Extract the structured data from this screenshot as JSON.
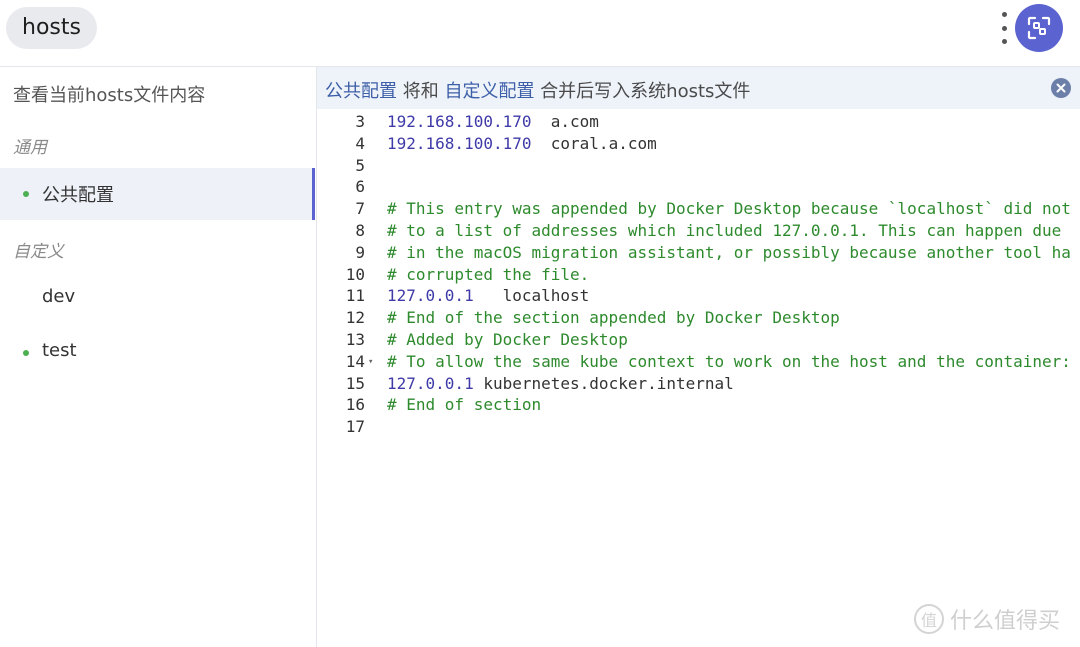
{
  "app": {
    "title": "hosts"
  },
  "toolbar": {
    "more_icon": "kebab-menu-icon",
    "action_icon": "switch-view-icon",
    "accent": "#5b63d0"
  },
  "sidebar": {
    "view_current": "查看当前hosts文件内容",
    "groups": [
      {
        "label": "通用"
      },
      {
        "label": "自定义"
      }
    ],
    "items": [
      {
        "label": "公共配置",
        "enabled": true,
        "active": true
      },
      {
        "label": "dev",
        "enabled": false,
        "active": false
      },
      {
        "label": "test",
        "enabled": true,
        "active": false
      }
    ]
  },
  "banner": {
    "part1": "公共配置",
    "part2": " 将和 ",
    "part3": "自定义配置",
    "part4": " 合并后写入系统hosts文件",
    "close_icon": "close-icon"
  },
  "editor": {
    "lines": [
      {
        "n": "3",
        "ip": "192.168.100.170",
        "rest": "  a.com",
        "type": "entry"
      },
      {
        "n": "4",
        "ip": "192.168.100.170",
        "rest": "  coral.a.com",
        "type": "entry"
      },
      {
        "n": "5",
        "text": "",
        "type": "blank"
      },
      {
        "n": "6",
        "text": "",
        "type": "blank"
      },
      {
        "n": "7",
        "text": "# This entry was appended by Docker Desktop because `localhost` did not",
        "type": "comment"
      },
      {
        "n": "8",
        "text": "# to a list of addresses which included 127.0.0.1. This can happen due",
        "type": "comment"
      },
      {
        "n": "9",
        "text": "# in the macOS migration assistant, or possibly because another tool ha",
        "type": "comment"
      },
      {
        "n": "10",
        "text": "# corrupted the file.",
        "type": "comment"
      },
      {
        "n": "11",
        "ip": "127.0.0.1",
        "rest": "   localhost",
        "type": "entry"
      },
      {
        "n": "12",
        "text": "# End of the section appended by Docker Desktop",
        "type": "comment"
      },
      {
        "n": "13",
        "text": "# Added by Docker Desktop",
        "type": "comment"
      },
      {
        "n": "14",
        "text": "# To allow the same kube context to work on the host and the container:",
        "type": "comment",
        "fold": true
      },
      {
        "n": "15",
        "ip": "127.0.0.1",
        "rest": " kubernetes.docker.internal",
        "type": "entry"
      },
      {
        "n": "16",
        "text": "# End of section",
        "type": "comment"
      },
      {
        "n": "17",
        "text": "",
        "type": "blank"
      }
    ]
  },
  "watermark": {
    "glyph": "值",
    "text": "什么值得买"
  }
}
